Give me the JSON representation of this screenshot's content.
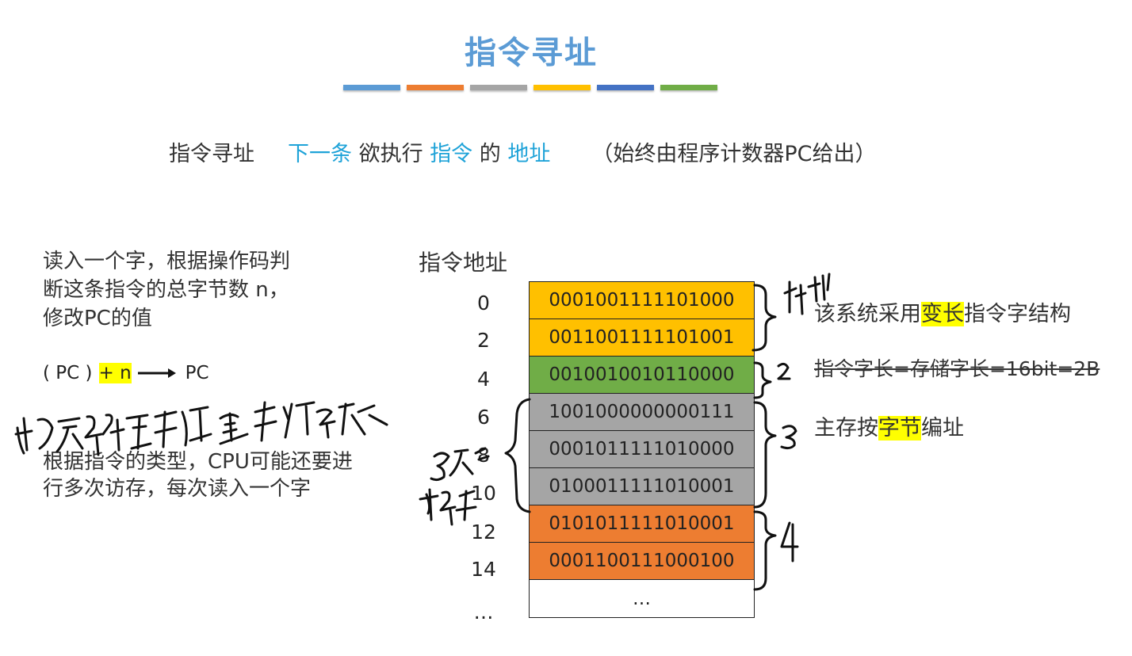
{
  "title": "指令寻址",
  "bar_colors": [
    "#5b9bd5",
    "#ed7d31",
    "#a5a5a5",
    "#ffc000",
    "#4472c4",
    "#70ad47"
  ],
  "definition": {
    "label": "指令寻址",
    "w1": "下一条",
    "w2": "欲执行",
    "w3": "指令",
    "w4": "的",
    "w5": "地址",
    "note": "（始终由程序计数器PC给出）"
  },
  "left_text": "读入一个字，根据操作码判\n断这条指令的总字节数 n，\n修改PC的值",
  "pc_formula": {
    "pc": "( PC )",
    "plus_n": "+ n",
    "target": "PC"
  },
  "left_text2": "根据指令的类型，CPU可能还要进\n行多次访存，每次读入一个字",
  "table": {
    "header": "指令地址",
    "rows": [
      {
        "addr": "0",
        "code": "0001001111101000",
        "color": "#ffc000"
      },
      {
        "addr": "2",
        "code": "0011001111101001",
        "color": "#ffc000"
      },
      {
        "addr": "4",
        "code": "0010010010110000",
        "color": "#70ad47"
      },
      {
        "addr": "6",
        "code": "1001000000000111",
        "color": "#a5a5a5"
      },
      {
        "addr": "8",
        "code": "0001011111010000",
        "color": "#a5a5a5"
      },
      {
        "addr": "10",
        "code": "0100011111010001",
        "color": "#a5a5a5"
      },
      {
        "addr": "12",
        "code": "0101011111010001",
        "color": "#ed7d31"
      },
      {
        "addr": "14",
        "code": "0001100111000100",
        "color": "#ed7d31"
      },
      {
        "addr": "…",
        "code": "…",
        "color": "#ffffff"
      }
    ]
  },
  "right": {
    "line1_a": "该系统采用",
    "line1_hl": "变长",
    "line1_b": "指令字结构",
    "line2": "指令字长=存储字长=16bit=2B",
    "line3_a": "主存按",
    "line3_hl": "字节",
    "line3_b": "编址"
  },
  "highlight_color": "#ffff00"
}
